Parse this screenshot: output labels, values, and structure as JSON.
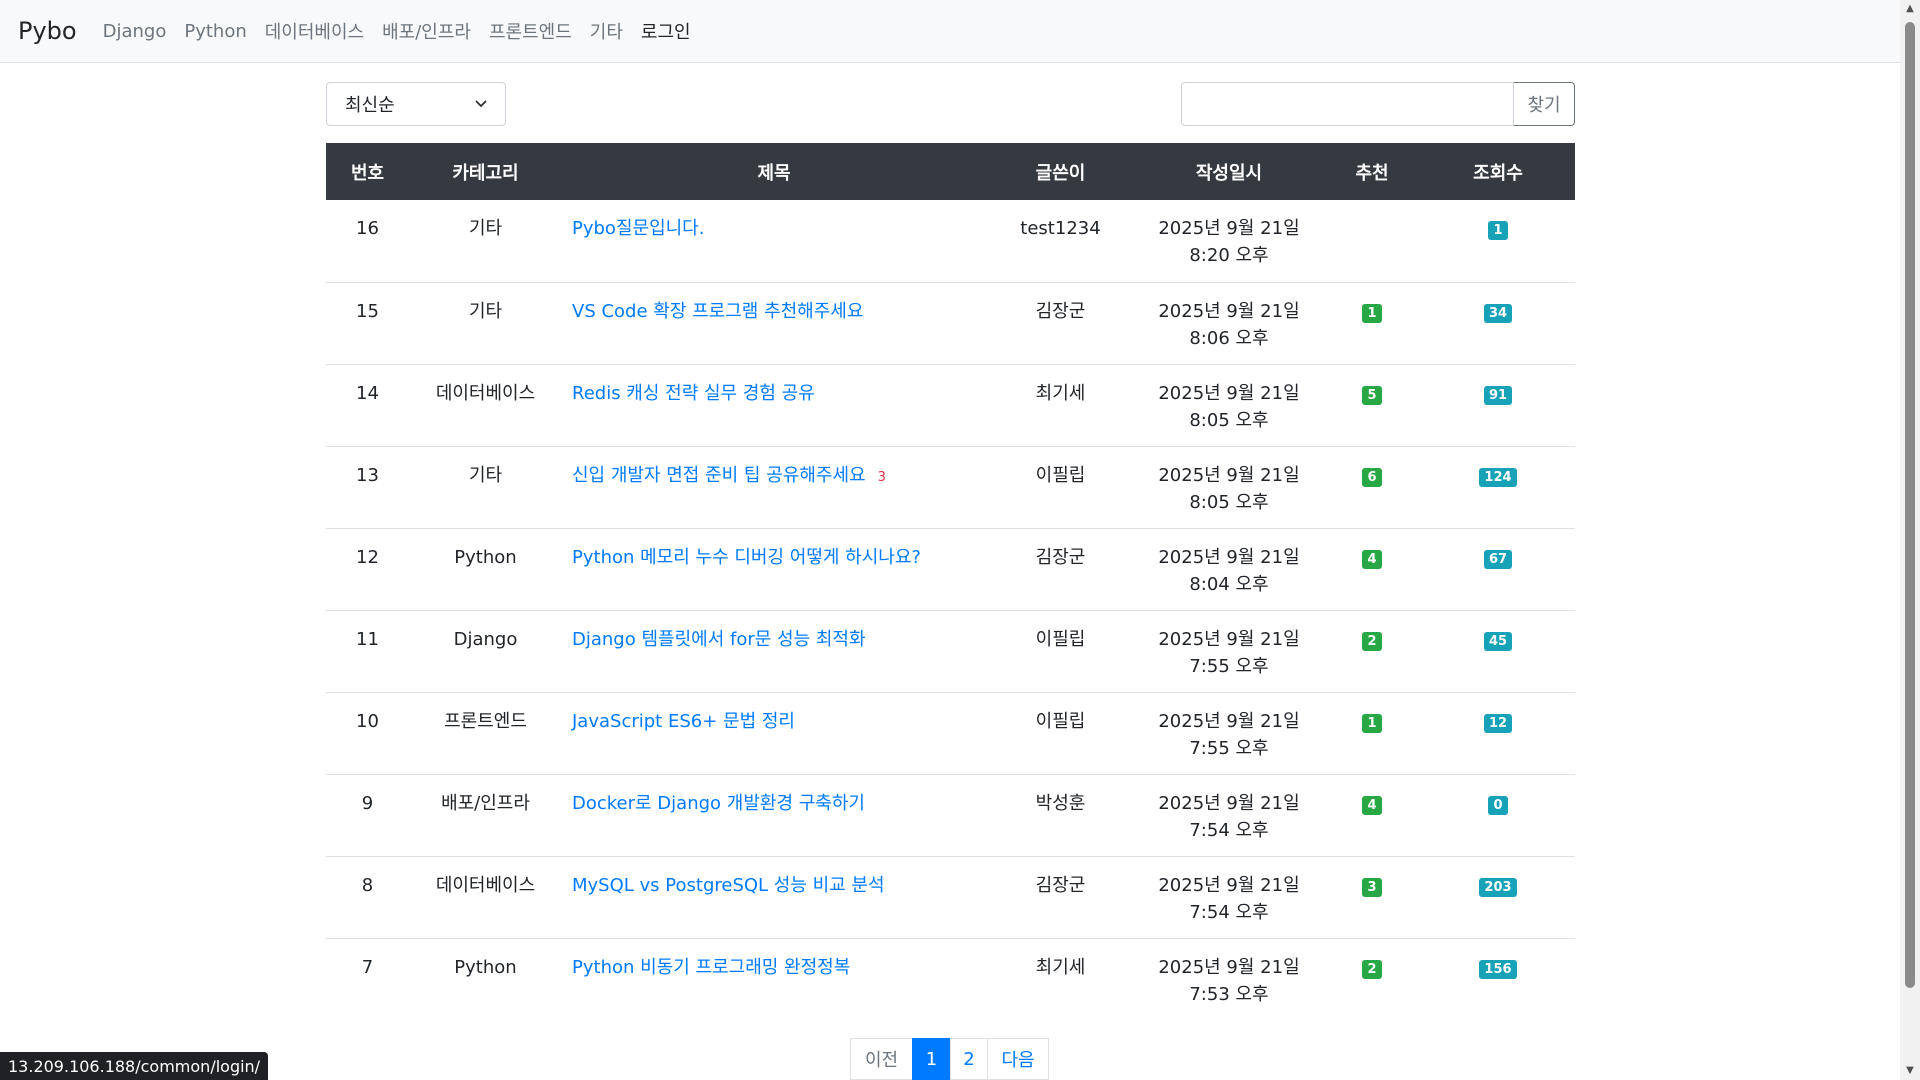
{
  "nav": {
    "brand": "Pybo",
    "items": [
      "Django",
      "Python",
      "데이터베이스",
      "배포/인프라",
      "프론트엔드",
      "기타"
    ],
    "login": "로그인"
  },
  "toolbar": {
    "sort_selected": "최신순",
    "search_value": "",
    "search_button": "찾기"
  },
  "table": {
    "headers": [
      "번호",
      "카테고리",
      "제목",
      "글쓴이",
      "작성일시",
      "추천",
      "조회수"
    ],
    "rows": [
      {
        "no": "16",
        "category": "기타",
        "title": "Pybo질문입니다.",
        "answers": "",
        "author": "test1234",
        "date": "2025년 9월 21일",
        "time": "8:20 오후",
        "votes": "",
        "views": "1"
      },
      {
        "no": "15",
        "category": "기타",
        "title": "VS Code 확장 프로그램 추천해주세요",
        "answers": "",
        "author": "김장군",
        "date": "2025년 9월 21일",
        "time": "8:06 오후",
        "votes": "1",
        "views": "34"
      },
      {
        "no": "14",
        "category": "데이터베이스",
        "title": "Redis 캐싱 전략 실무 경험 공유",
        "answers": "",
        "author": "최기세",
        "date": "2025년 9월 21일",
        "time": "8:05 오후",
        "votes": "5",
        "views": "91"
      },
      {
        "no": "13",
        "category": "기타",
        "title": "신입 개발자 면접 준비 팁 공유해주세요",
        "answers": "3",
        "author": "이필립",
        "date": "2025년 9월 21일",
        "time": "8:05 오후",
        "votes": "6",
        "views": "124"
      },
      {
        "no": "12",
        "category": "Python",
        "title": "Python 메모리 누수 디버깅 어떻게 하시나요?",
        "answers": "",
        "author": "김장군",
        "date": "2025년 9월 21일",
        "time": "8:04 오후",
        "votes": "4",
        "views": "67"
      },
      {
        "no": "11",
        "category": "Django",
        "title": "Django 템플릿에서 for문 성능 최적화",
        "answers": "",
        "author": "이필립",
        "date": "2025년 9월 21일",
        "time": "7:55 오후",
        "votes": "2",
        "views": "45"
      },
      {
        "no": "10",
        "category": "프론트엔드",
        "title": "JavaScript ES6+ 문법 정리",
        "answers": "",
        "author": "이필립",
        "date": "2025년 9월 21일",
        "time": "7:55 오후",
        "votes": "1",
        "views": "12"
      },
      {
        "no": "9",
        "category": "배포/인프라",
        "title": "Docker로 Django 개발환경 구축하기",
        "answers": "",
        "author": "박성훈",
        "date": "2025년 9월 21일",
        "time": "7:54 오후",
        "votes": "4",
        "views": "0"
      },
      {
        "no": "8",
        "category": "데이터베이스",
        "title": "MySQL vs PostgreSQL 성능 비교 분석",
        "answers": "",
        "author": "김장군",
        "date": "2025년 9월 21일",
        "time": "7:54 오후",
        "votes": "3",
        "views": "203"
      },
      {
        "no": "7",
        "category": "Python",
        "title": "Python 비동기 프로그래밍 완정정복",
        "answers": "",
        "author": "최기세",
        "date": "2025년 9월 21일",
        "time": "7:53 오후",
        "votes": "2",
        "views": "156"
      }
    ]
  },
  "pagination": {
    "prev": "이전",
    "pages": [
      "1",
      "2"
    ],
    "active": "1",
    "next": "다음"
  },
  "status_url": "13.209.106.188/common/login/",
  "colors": {
    "link": "#007bff",
    "header_bg": "#343a40",
    "vote_badge": "#28a745",
    "view_badge": "#17a2b8",
    "answer_count": "#dc3545"
  }
}
